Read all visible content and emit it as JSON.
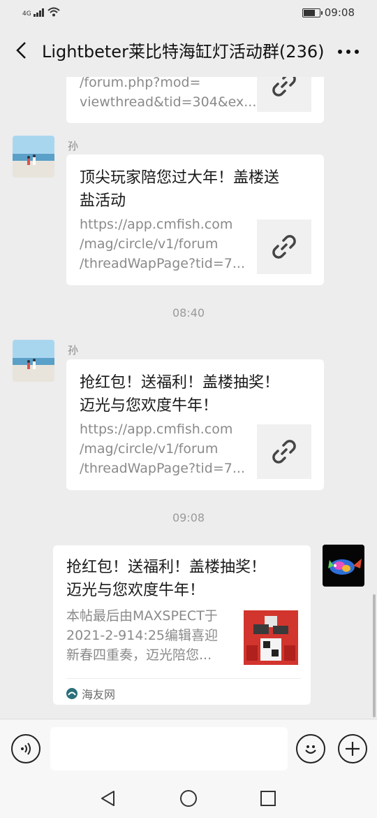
{
  "status_bar": {
    "network": "4G",
    "time": "09:08",
    "battery_level": 0.75
  },
  "header": {
    "title": "Lightbeter莱比特海缸灯活动群(236)"
  },
  "messages": [
    {
      "type": "link",
      "desc_lines": [
        "/forum.php?mod=",
        "viewthread&tid=304&ex..."
      ]
    },
    {
      "type": "link",
      "sender": "孙",
      "title_lines": [
        "顶尖玩家陪您过大年！盖楼送",
        "盐活动"
      ],
      "desc_lines": [
        "https://app.cmfish.com",
        "/mag/circle/v1/forum",
        "/threadWapPage?tid=7..."
      ]
    },
    {
      "type": "time",
      "text": "08:40"
    },
    {
      "type": "link",
      "sender": "孙",
      "title_lines": [
        "抢红包！送福利！盖楼抽奖！",
        "迈光与您欢度牛年！"
      ],
      "desc_lines": [
        "https://app.cmfish.com",
        "/mag/circle/v1/forum",
        "/threadWapPage?tid=7..."
      ]
    },
    {
      "type": "time",
      "text": "09:08"
    },
    {
      "type": "article",
      "title_lines": [
        "抢红包！送福利！盖楼抽奖！",
        "迈光与您欢度牛年！"
      ],
      "desc_lines": [
        "本帖最后由MAXSPECT于",
        "2021-2-914:25编辑喜迎",
        "新春四重奏，迈光陪您..."
      ],
      "source": "海友网"
    }
  ],
  "input_bar": {
    "placeholder": ""
  },
  "icons": {
    "back": "back-arrow-icon",
    "more": "more-icon",
    "link": "link-icon",
    "voice": "voice-icon",
    "emoji": "emoji-icon",
    "plus": "plus-icon"
  }
}
